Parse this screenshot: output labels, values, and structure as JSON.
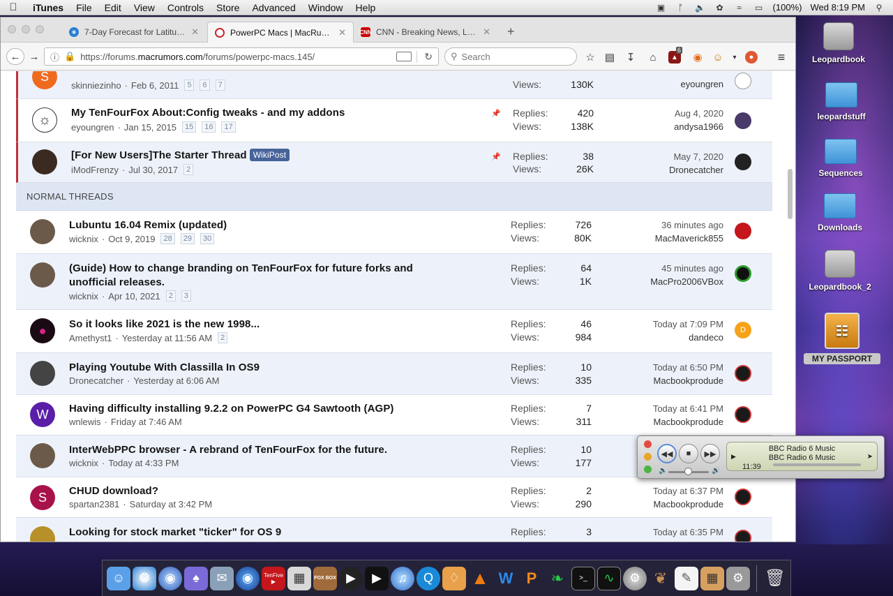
{
  "menubar": {
    "app": "iTunes",
    "items": [
      "File",
      "Edit",
      "View",
      "Controls",
      "Store",
      "Advanced",
      "Window",
      "Help"
    ],
    "battery": "(100%)",
    "clock": "Wed 8:19 PM"
  },
  "browser": {
    "tabs": [
      {
        "title": "7-Day Forecast for Latitud…",
        "favicon": "weather-icon"
      },
      {
        "title": "PowerPC Macs | MacRumo…",
        "favicon": "macrumors-icon"
      },
      {
        "title": "CNN - Breaking News, Lat…",
        "favicon": "cnn-icon"
      }
    ],
    "url_prefix": "https://forums.",
    "url_host": "macrumors.com",
    "url_path": "/forums/powerpc-macs.145/",
    "search_placeholder": "Search",
    "ublock_count": "6"
  },
  "forum": {
    "section_label": "NORMAL THREADS",
    "stat_labels": {
      "replies": "Replies:",
      "views": "Views:"
    },
    "sticky_threads": [
      {
        "title": "",
        "author": "skinniezinho",
        "date": "Feb 6, 2011",
        "pages": [
          "5",
          "6",
          "7"
        ],
        "replies": "",
        "views": "130K",
        "last_date": "",
        "last_user": "eyoungren",
        "avatar_color": "#f06a1e",
        "avatar_letter": "S"
      },
      {
        "title": "My TenFourFox About:Config tweaks - and my addons",
        "author": "eyoungren",
        "date": "Jan 15, 2015",
        "pages": [
          "15",
          "16",
          "17"
        ],
        "replies": "420",
        "views": "138K",
        "last_date": "Aug 4, 2020",
        "last_user": "andysa1966"
      },
      {
        "title": "[For New Users]The Starter Thread",
        "badge": "WikiPost",
        "author": "iModFrenzy",
        "date": "Jul 30, 2017",
        "pages": [
          "2"
        ],
        "replies": "38",
        "views": "26K",
        "last_date": "May 7, 2020",
        "last_user": "Dronecatcher"
      }
    ],
    "threads": [
      {
        "title": "Lubuntu 16.04 Remix (updated)",
        "author": "wicknix",
        "date": "Oct 9, 2019",
        "pages": [
          "28",
          "29",
          "30"
        ],
        "replies": "726",
        "views": "80K",
        "last_date": "36 minutes ago",
        "last_user": "MacMaverick855"
      },
      {
        "title": "(Guide) How to change branding on TenFourFox for future forks and",
        "title2": "unofficial releases.",
        "author": "wicknix",
        "date": "Apr 10, 2021",
        "pages": [
          "2",
          "3"
        ],
        "replies": "64",
        "views": "1K",
        "last_date": "45 minutes ago",
        "last_user": "MacPro2006VBox"
      },
      {
        "title": "So it looks like 2021 is the new 1998...",
        "author": "Amethyst1",
        "date": "Yesterday at 11:56 AM",
        "pages": [
          "2"
        ],
        "replies": "46",
        "views": "984",
        "last_date": "Today at 7:09 PM",
        "last_user": "dandeco",
        "last_letter": "D"
      },
      {
        "title": "Playing Youtube With Classilla In OS9",
        "author": "Dronecatcher",
        "date": "Yesterday at 6:06 AM",
        "pages": [],
        "replies": "10",
        "views": "335",
        "last_date": "Today at 6:50 PM",
        "last_user": "Macbookprodude"
      },
      {
        "title": "Having difficulty installing 9.2.2 on PowerPC G4 Sawtooth (AGP)",
        "author": "wnlewis",
        "date": "Friday at 7:46 AM",
        "pages": [],
        "replies": "7",
        "views": "311",
        "last_date": "Today at 6:41 PM",
        "last_user": "Macbookprodude",
        "avatar_letter": "W"
      },
      {
        "title": "InterWebPPC browser - A rebrand of TenFourFox for the future.",
        "author": "wicknix",
        "date": "Today at 4:33 PM",
        "pages": [],
        "replies": "10",
        "views": "177",
        "last_date": "",
        "last_user": ""
      },
      {
        "title": "CHUD download?",
        "author": "spartan2381",
        "date": "Saturday at 3:42 PM",
        "pages": [],
        "replies": "2",
        "views": "290",
        "last_date": "Today at 6:37 PM",
        "last_user": "Macbookprodude",
        "avatar_letter": "S"
      },
      {
        "title": "Looking for stock market \"ticker\" for OS 9",
        "author": "",
        "date": "",
        "pages": [],
        "replies": "3",
        "views": "",
        "last_date": "Today at 6:35 PM",
        "last_user": ""
      }
    ]
  },
  "desktop": {
    "icons": [
      "Leopardbook",
      "leopardstuff",
      "Sequences",
      "Downloads",
      "Leopardbook_2",
      "MY PASSPORT"
    ]
  },
  "miniplayer": {
    "line1": "BBC Radio 6 Music",
    "line2": "BBC Radio 6 Music",
    "time": "11:39"
  },
  "dock": {
    "items": [
      "finder-icon",
      "safari-icon",
      "network-icon",
      "game-icon",
      "mail-icon",
      "firefox-icon",
      "tenfive-tube-icon",
      "photo-icon",
      "foxbox-icon",
      "quicktime-icon",
      "player-icon",
      "itunes-icon",
      "quicktime-q-icon",
      "ticket-icon",
      "vlc-icon",
      "word-icon",
      "pages-icon",
      "app-icon",
      "terminal-icon",
      "activity-icon",
      "system-prefs-icon",
      "squirrel-icon",
      "text-icon",
      "calculator-icon",
      "utility-icon",
      "trash-icon"
    ],
    "tenfive_label": "TenFive",
    "foxbox_label": "FOX BOX"
  }
}
